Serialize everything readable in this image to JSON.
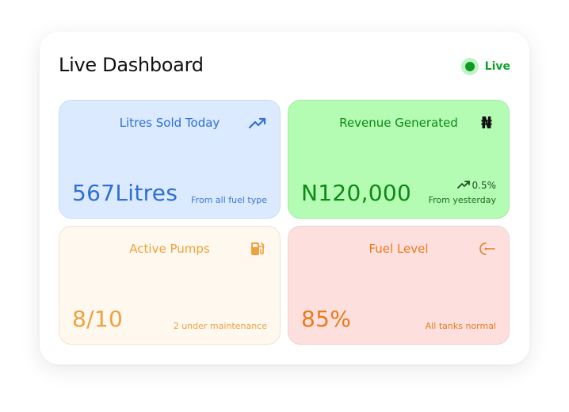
{
  "header": {
    "title": "Live Dashboard",
    "live_label": "Live"
  },
  "colors": {
    "live_dot": "#0f9a22",
    "blue": "#2f6fd6",
    "green": "#0c8a14",
    "orange": "#f0a03c",
    "deep_orange": "#e87a1e"
  },
  "tiles": {
    "litres": {
      "label": "Litres Sold Today",
      "value": "567Litres",
      "note": "From all fuel type",
      "icon": "trending-up-icon"
    },
    "revenue": {
      "label": "Revenue Generated",
      "value": "N120,000",
      "trend": "0.5%",
      "note": "From yesterday",
      "icon": "naira-icon",
      "icon_glyph": "₦"
    },
    "pumps": {
      "label": "Active Pumps",
      "value": "8/10",
      "note": "2 under maintenance",
      "icon": "fuel-pump-icon"
    },
    "fuel": {
      "label": "Fuel Level",
      "value": "85%",
      "note": "All tanks normal",
      "icon": "gauge-icon"
    }
  }
}
